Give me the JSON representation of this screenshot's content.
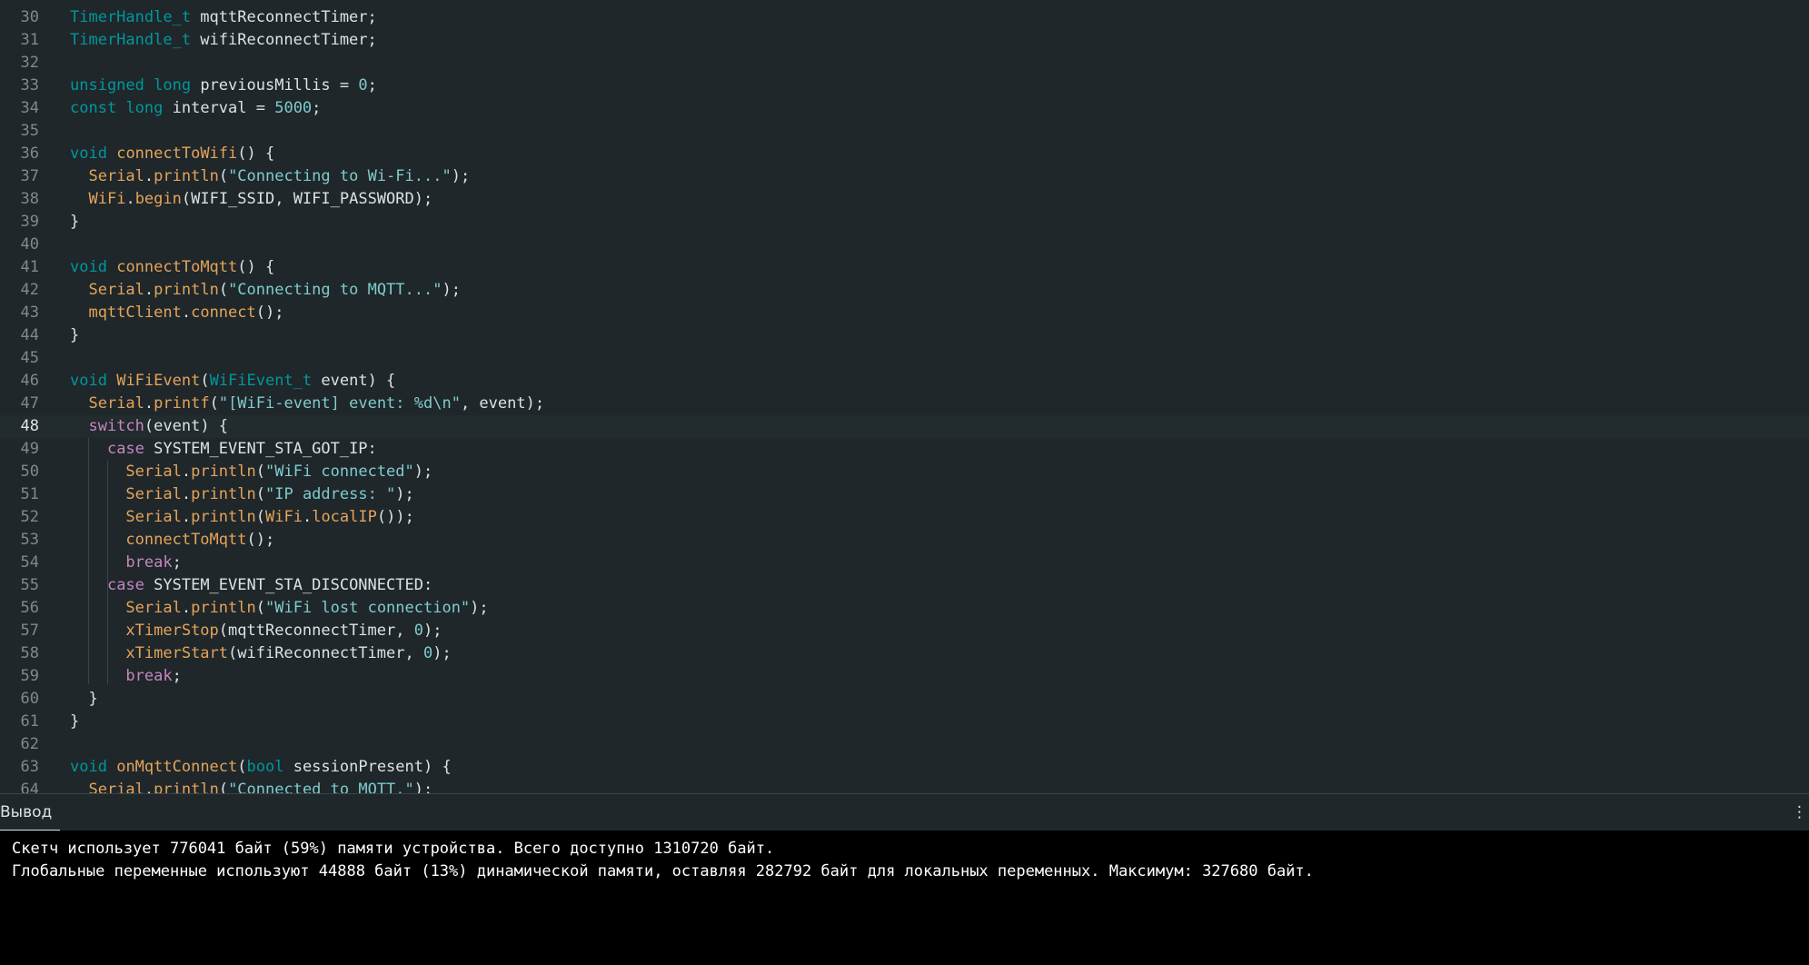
{
  "editor": {
    "current_line": "48",
    "lines": [
      {
        "num": "30",
        "tokens": [
          {
            "t": "TimerHandle_t",
            "c": "ty"
          },
          {
            "t": " mqttReconnectTimer;",
            "c": ""
          }
        ]
      },
      {
        "num": "31",
        "tokens": [
          {
            "t": "TimerHandle_t",
            "c": "ty"
          },
          {
            "t": " wifiReconnectTimer;",
            "c": ""
          }
        ]
      },
      {
        "num": "32",
        "tokens": []
      },
      {
        "num": "33",
        "tokens": [
          {
            "t": "unsigned",
            "c": "ty"
          },
          {
            "t": " ",
            "c": ""
          },
          {
            "t": "long",
            "c": "ty"
          },
          {
            "t": " previousMillis = ",
            "c": ""
          },
          {
            "t": "0",
            "c": "nu"
          },
          {
            "t": ";",
            "c": ""
          }
        ]
      },
      {
        "num": "34",
        "tokens": [
          {
            "t": "const",
            "c": "ty"
          },
          {
            "t": " ",
            "c": ""
          },
          {
            "t": "long",
            "c": "ty"
          },
          {
            "t": " interval = ",
            "c": ""
          },
          {
            "t": "5000",
            "c": "nu"
          },
          {
            "t": ";",
            "c": ""
          }
        ]
      },
      {
        "num": "35",
        "tokens": []
      },
      {
        "num": "36",
        "tokens": [
          {
            "t": "void",
            "c": "ty"
          },
          {
            "t": " ",
            "c": ""
          },
          {
            "t": "connectToWifi",
            "c": "fn"
          },
          {
            "t": "() {",
            "c": ""
          }
        ]
      },
      {
        "num": "37",
        "tokens": [
          {
            "t": "  ",
            "c": ""
          },
          {
            "t": "Serial",
            "c": "fn"
          },
          {
            "t": ".",
            "c": ""
          },
          {
            "t": "println",
            "c": "fn"
          },
          {
            "t": "(",
            "c": ""
          },
          {
            "t": "\"Connecting to Wi-Fi...\"",
            "c": "st"
          },
          {
            "t": ");",
            "c": ""
          }
        ]
      },
      {
        "num": "38",
        "tokens": [
          {
            "t": "  ",
            "c": ""
          },
          {
            "t": "WiFi",
            "c": "fn"
          },
          {
            "t": ".",
            "c": ""
          },
          {
            "t": "begin",
            "c": "fn"
          },
          {
            "t": "(WIFI_SSID, WIFI_PASSWORD);",
            "c": ""
          }
        ]
      },
      {
        "num": "39",
        "tokens": [
          {
            "t": "}",
            "c": ""
          }
        ]
      },
      {
        "num": "40",
        "tokens": []
      },
      {
        "num": "41",
        "tokens": [
          {
            "t": "void",
            "c": "ty"
          },
          {
            "t": " ",
            "c": ""
          },
          {
            "t": "connectToMqtt",
            "c": "fn"
          },
          {
            "t": "() {",
            "c": ""
          }
        ]
      },
      {
        "num": "42",
        "tokens": [
          {
            "t": "  ",
            "c": ""
          },
          {
            "t": "Serial",
            "c": "fn"
          },
          {
            "t": ".",
            "c": ""
          },
          {
            "t": "println",
            "c": "fn"
          },
          {
            "t": "(",
            "c": ""
          },
          {
            "t": "\"Connecting to MQTT...\"",
            "c": "st"
          },
          {
            "t": ");",
            "c": ""
          }
        ]
      },
      {
        "num": "43",
        "tokens": [
          {
            "t": "  ",
            "c": ""
          },
          {
            "t": "mqttClient",
            "c": "fn"
          },
          {
            "t": ".",
            "c": ""
          },
          {
            "t": "connect",
            "c": "fn"
          },
          {
            "t": "();",
            "c": ""
          }
        ]
      },
      {
        "num": "44",
        "tokens": [
          {
            "t": "}",
            "c": ""
          }
        ]
      },
      {
        "num": "45",
        "tokens": []
      },
      {
        "num": "46",
        "tokens": [
          {
            "t": "void",
            "c": "ty"
          },
          {
            "t": " ",
            "c": ""
          },
          {
            "t": "WiFiEvent",
            "c": "fn"
          },
          {
            "t": "(",
            "c": ""
          },
          {
            "t": "WiFiEvent_t",
            "c": "ty"
          },
          {
            "t": " event) {",
            "c": ""
          }
        ]
      },
      {
        "num": "47",
        "tokens": [
          {
            "t": "  ",
            "c": ""
          },
          {
            "t": "Serial",
            "c": "fn"
          },
          {
            "t": ".",
            "c": ""
          },
          {
            "t": "printf",
            "c": "fn"
          },
          {
            "t": "(",
            "c": ""
          },
          {
            "t": "\"[WiFi-event] event: %d\\n\"",
            "c": "st"
          },
          {
            "t": ", event);",
            "c": ""
          }
        ]
      },
      {
        "num": "48",
        "tokens": [
          {
            "t": "  ",
            "c": ""
          },
          {
            "t": "switch",
            "c": "kw"
          },
          {
            "t": "(event) {",
            "c": ""
          }
        ]
      },
      {
        "num": "49",
        "tokens": [
          {
            "t": "    ",
            "c": ""
          },
          {
            "t": "case",
            "c": "kw"
          },
          {
            "t": " SYSTEM_EVENT_STA_GOT_IP:",
            "c": ""
          }
        ]
      },
      {
        "num": "50",
        "tokens": [
          {
            "t": "      ",
            "c": ""
          },
          {
            "t": "Serial",
            "c": "fn"
          },
          {
            "t": ".",
            "c": ""
          },
          {
            "t": "println",
            "c": "fn"
          },
          {
            "t": "(",
            "c": ""
          },
          {
            "t": "\"WiFi connected\"",
            "c": "st"
          },
          {
            "t": ");",
            "c": ""
          }
        ]
      },
      {
        "num": "51",
        "tokens": [
          {
            "t": "      ",
            "c": ""
          },
          {
            "t": "Serial",
            "c": "fn"
          },
          {
            "t": ".",
            "c": ""
          },
          {
            "t": "println",
            "c": "fn"
          },
          {
            "t": "(",
            "c": ""
          },
          {
            "t": "\"IP address: \"",
            "c": "st"
          },
          {
            "t": ");",
            "c": ""
          }
        ]
      },
      {
        "num": "52",
        "tokens": [
          {
            "t": "      ",
            "c": ""
          },
          {
            "t": "Serial",
            "c": "fn"
          },
          {
            "t": ".",
            "c": ""
          },
          {
            "t": "println",
            "c": "fn"
          },
          {
            "t": "(",
            "c": ""
          },
          {
            "t": "WiFi",
            "c": "fn"
          },
          {
            "t": ".",
            "c": ""
          },
          {
            "t": "localIP",
            "c": "fn"
          },
          {
            "t": "());",
            "c": ""
          }
        ]
      },
      {
        "num": "53",
        "tokens": [
          {
            "t": "      ",
            "c": ""
          },
          {
            "t": "connectToMqtt",
            "c": "fn"
          },
          {
            "t": "();",
            "c": ""
          }
        ]
      },
      {
        "num": "54",
        "tokens": [
          {
            "t": "      ",
            "c": ""
          },
          {
            "t": "break",
            "c": "kw"
          },
          {
            "t": ";",
            "c": ""
          }
        ]
      },
      {
        "num": "55",
        "tokens": [
          {
            "t": "    ",
            "c": ""
          },
          {
            "t": "case",
            "c": "kw"
          },
          {
            "t": " SYSTEM_EVENT_STA_DISCONNECTED:",
            "c": ""
          }
        ]
      },
      {
        "num": "56",
        "tokens": [
          {
            "t": "      ",
            "c": ""
          },
          {
            "t": "Serial",
            "c": "fn"
          },
          {
            "t": ".",
            "c": ""
          },
          {
            "t": "println",
            "c": "fn"
          },
          {
            "t": "(",
            "c": ""
          },
          {
            "t": "\"WiFi lost connection\"",
            "c": "st"
          },
          {
            "t": ");",
            "c": ""
          }
        ]
      },
      {
        "num": "57",
        "tokens": [
          {
            "t": "      ",
            "c": ""
          },
          {
            "t": "xTimerStop",
            "c": "fn"
          },
          {
            "t": "(mqttReconnectTimer, ",
            "c": ""
          },
          {
            "t": "0",
            "c": "nu"
          },
          {
            "t": ");",
            "c": ""
          }
        ]
      },
      {
        "num": "58",
        "tokens": [
          {
            "t": "      ",
            "c": ""
          },
          {
            "t": "xTimerStart",
            "c": "fn"
          },
          {
            "t": "(wifiReconnectTimer, ",
            "c": ""
          },
          {
            "t": "0",
            "c": "nu"
          },
          {
            "t": ");",
            "c": ""
          }
        ]
      },
      {
        "num": "59",
        "tokens": [
          {
            "t": "      ",
            "c": ""
          },
          {
            "t": "break",
            "c": "kw"
          },
          {
            "t": ";",
            "c": ""
          }
        ]
      },
      {
        "num": "60",
        "tokens": [
          {
            "t": "  }",
            "c": ""
          }
        ]
      },
      {
        "num": "61",
        "tokens": [
          {
            "t": "}",
            "c": ""
          }
        ]
      },
      {
        "num": "62",
        "tokens": []
      },
      {
        "num": "63",
        "tokens": [
          {
            "t": "void",
            "c": "ty"
          },
          {
            "t": " ",
            "c": ""
          },
          {
            "t": "onMqttConnect",
            "c": "fn"
          },
          {
            "t": "(",
            "c": ""
          },
          {
            "t": "bool",
            "c": "ty"
          },
          {
            "t": " sessionPresent) {",
            "c": ""
          }
        ]
      },
      {
        "num": "64",
        "tokens": [
          {
            "t": "  ",
            "c": ""
          },
          {
            "t": "Serial",
            "c": "fn"
          },
          {
            "t": ".",
            "c": ""
          },
          {
            "t": "println",
            "c": "fn"
          },
          {
            "t": "(",
            "c": ""
          },
          {
            "t": "\"Connected to MQTT.\"",
            "c": "st"
          },
          {
            "t": ");",
            "c": ""
          }
        ]
      }
    ]
  },
  "output": {
    "title": "Вывод",
    "menu_glyph": "⋮",
    "lines": [
      "Скетч использует 776041 байт (59%) памяти устройства. Всего доступно 1310720 байт.",
      "Глобальные переменные используют 44888 байт (13%) динамической памяти, оставляя 282792 байт для локальных переменных. Максимум: 327680 байт."
    ]
  }
}
